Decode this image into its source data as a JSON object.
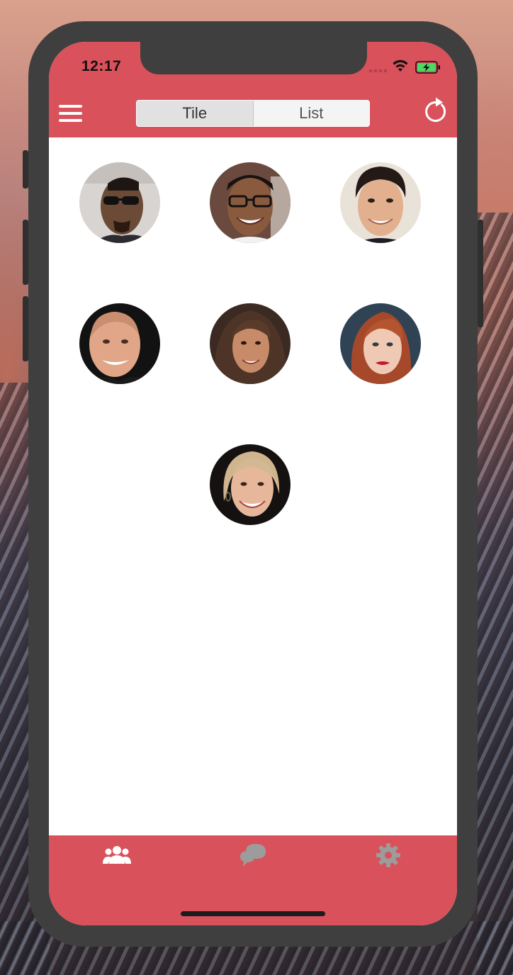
{
  "status_bar": {
    "time": "12:17",
    "icons": [
      "cellular-signal-icon",
      "wifi-icon",
      "battery-charging-icon"
    ]
  },
  "header": {
    "menu_icon": "hamburger-menu-icon",
    "segments": [
      {
        "label": "Tile",
        "selected": true
      },
      {
        "label": "List",
        "selected": false
      }
    ],
    "refresh_icon": "refresh-icon"
  },
  "contacts": [
    {
      "photo": "man-sunglasses"
    },
    {
      "photo": "man-glasses-smiling"
    },
    {
      "photo": "man-dark-hair-smiling"
    },
    {
      "photo": "man-bald-smiling"
    },
    {
      "photo": "woman-brown-hair"
    },
    {
      "photo": "woman-red-hair"
    },
    {
      "photo": "woman-blonde-smiling"
    }
  ],
  "tabbar": {
    "tabs": [
      {
        "icon": "people-icon",
        "selected": true
      },
      {
        "icon": "chat-bubbles-icon",
        "selected": false
      },
      {
        "icon": "gear-icon",
        "selected": false
      }
    ]
  },
  "colors": {
    "accent": "#d9515a",
    "tab_selected": "#ffffff",
    "tab_unselected": "#9a9a9a"
  }
}
